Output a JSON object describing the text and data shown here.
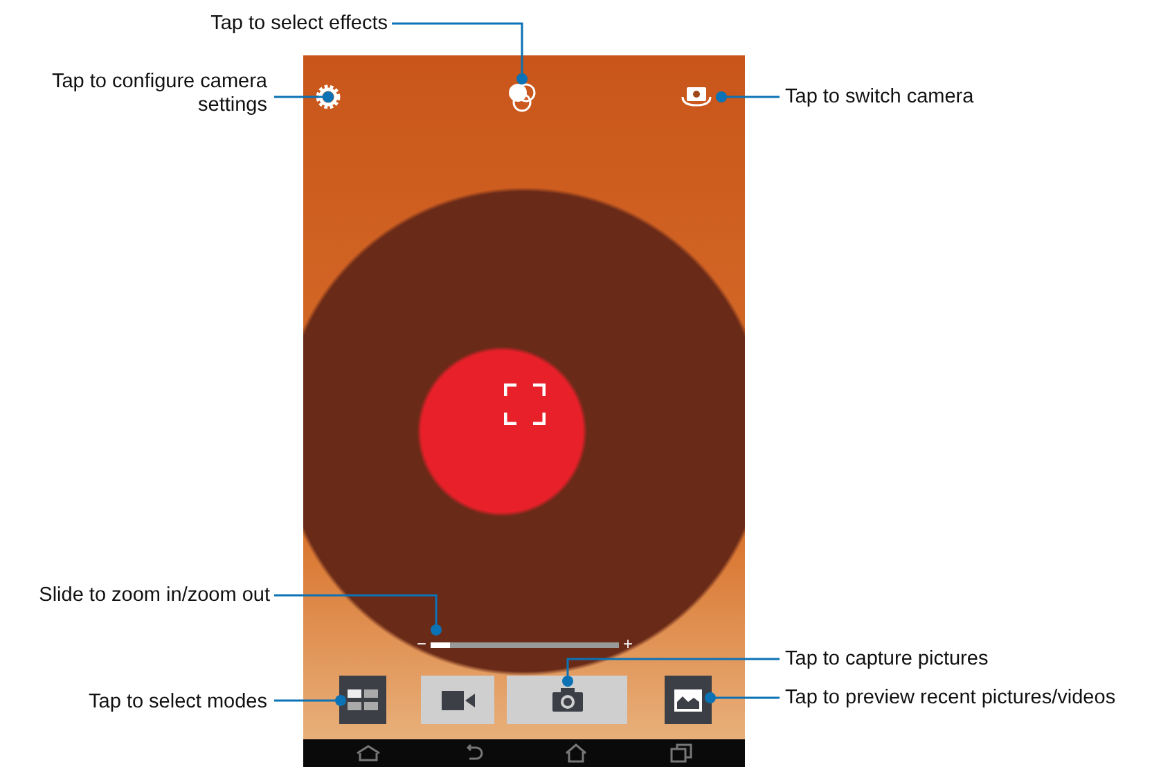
{
  "callouts": [
    {
      "text": "Tap to select effects"
    },
    {
      "text": "Tap to configure camera settings"
    },
    {
      "text": "Tap to switch camera"
    },
    {
      "text": "Slide to zoom in/zoom out"
    },
    {
      "text": "Tap to capture pictures"
    },
    {
      "text": "Tap to select modes"
    },
    {
      "text": "Tap to preview recent pictures/videos"
    }
  ],
  "camera": {
    "zoom": {
      "minus": "−",
      "plus": "+",
      "level": 0.1
    },
    "buttons": [
      {
        "kind": "modes"
      },
      {
        "kind": "video"
      },
      {
        "kind": "photo"
      },
      {
        "kind": "gallery"
      }
    ]
  }
}
